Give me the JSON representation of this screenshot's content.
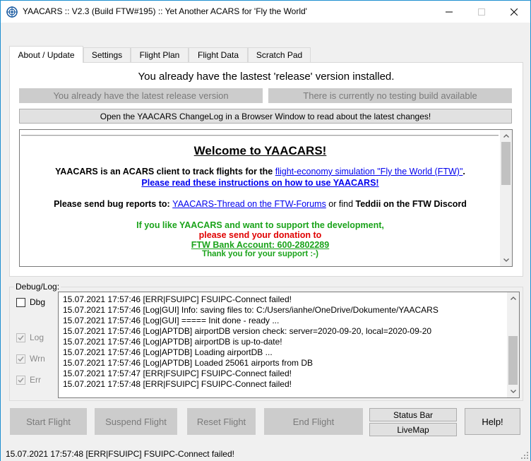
{
  "window": {
    "title": "YAACARS :: V2.3 (Build FTW#195) :: Yet Another ACARS for 'Fly the World'",
    "app_icon": "radar-target-icon",
    "controls": [
      "minimize-icon",
      "maximize-icon",
      "close-icon"
    ]
  },
  "tabs": [
    {
      "label": "About / Update",
      "active": true
    },
    {
      "label": "Settings",
      "active": false
    },
    {
      "label": "Flight Plan",
      "active": false
    },
    {
      "label": "Flight Data",
      "active": false
    },
    {
      "label": "Scratch Pad",
      "active": false
    }
  ],
  "about": {
    "headline": "You already have the lastest 'release' version installed.",
    "release_button": "You already have the latest release version",
    "testing_button": "There is currently no testing build available",
    "changelog_button": "Open the YAACARS ChangeLog in a Browser Window to read about the latest changes!",
    "browser": {
      "welcome": "Welcome to YAACARS!",
      "intro_text": "YAACARS is an ACARS client to track flights for the ",
      "intro_link": "flight-economy simulation \"Fly the World (FTW)\"",
      "intro_end": ".",
      "instructions_link": "Please read these instructions on how to use YAACARS!",
      "bug_text": "Please send bug reports to: ",
      "bug_link": "YAACARS-Thread on the FTW-Forums",
      "bug_or": " or find ",
      "bug_discord": "Teddii on the FTW Discord",
      "support_line": "If you like YAACARS and want to support the development,",
      "donation_line": "please send your donation to",
      "bank_line": "FTW Bank Account: 600-2802289",
      "thanks_line": "Thank you for your support :-)"
    }
  },
  "debug": {
    "group_label": "Debug/Log:",
    "checkboxes": [
      {
        "label": "Dbg",
        "checked": false,
        "enabled": true
      },
      {
        "label": "Log",
        "checked": true,
        "enabled": false
      },
      {
        "label": "Wrn",
        "checked": true,
        "enabled": false
      },
      {
        "label": "Err",
        "checked": true,
        "enabled": false
      }
    ],
    "log_lines": [
      "15.07.2021 17:57:46 [ERR|FSUIPC] FSUIPC-Connect failed!",
      "15.07.2021 17:57:46 [Log|GUI] Info: saving files to: C:/Users/ianhe/OneDrive/Dokumente/YAACARS",
      "15.07.2021 17:57:46 [Log|GUI] ===== Init done - ready ...",
      "15.07.2021 17:57:46 [Log|APTDB] airportDB version check: server=2020-09-20, local=2020-09-20",
      "15.07.2021 17:57:46 [Log|APTDB] airportDB is up-to-date!",
      "15.07.2021 17:57:46 [Log|APTDB] Loading airportDB ...",
      "15.07.2021 17:57:46 [Log|APTDB] Loaded 25061 airports from DB",
      "15.07.2021 17:57:47 [ERR|FSUIPC] FSUIPC-Connect failed!",
      "15.07.2021 17:57:48 [ERR|FSUIPC] FSUIPC-Connect failed!"
    ]
  },
  "buttons": {
    "start_flight": "Start Flight",
    "suspend_flight": "Suspend Flight",
    "reset_flight": "Reset Flight",
    "end_flight": "End Flight",
    "status_bar": "Status Bar",
    "livemap": "LiveMap",
    "help": "Help!"
  },
  "status": {
    "text": "15.07.2021 17:57:48 [ERR|FSUIPC] FSUIPC-Connect failed!"
  }
}
